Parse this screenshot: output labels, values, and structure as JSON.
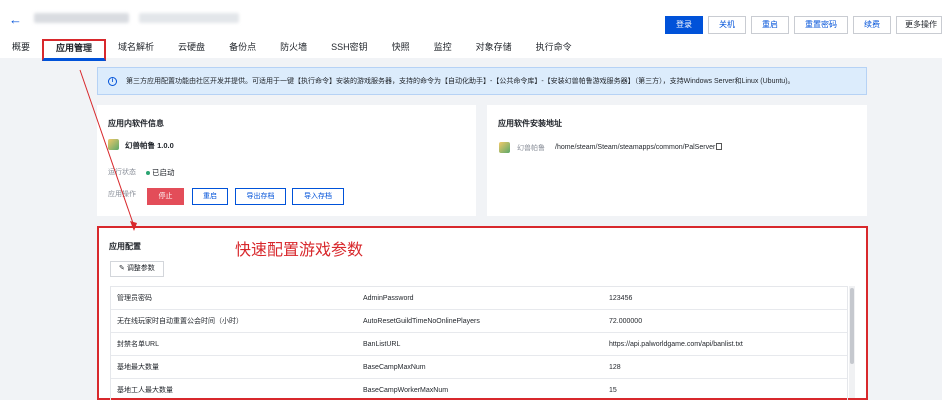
{
  "header": {
    "back_glyph": "←",
    "actions": [
      "登录",
      "关机",
      "重启",
      "重置密码",
      "续费",
      "更多操作"
    ]
  },
  "tabs": [
    "概要",
    "应用管理",
    "域名解析",
    "云硬盘",
    "备份点",
    "防火墙",
    "SSH密钥",
    "快照",
    "监控",
    "对象存储",
    "执行命令"
  ],
  "notice": {
    "icon": "info-icon",
    "text": "第三方应用配置功能由社区开发并提供。可适用于一键【执行命令】安装的游戏服务器，支持的命令为【自动化助手】-【公共命令库】-【安装幻兽帕鲁游戏服务器】（第三方），支持Windows Server和Linux (Ubuntu)。"
  },
  "software_info": {
    "title": "应用内软件信息",
    "app_name": "幻兽帕鲁 1.0.0",
    "status_label": "运行状态",
    "status_value": "已启动",
    "ops_label": "应用操作",
    "ops": [
      "停止",
      "重启",
      "导出存档",
      "导入存档"
    ]
  },
  "install_path": {
    "title": "应用软件安装地址",
    "app_label": "幻兽帕鲁",
    "path": "/home/steam/Steam/steamapps/common/PalServer"
  },
  "config": {
    "title": "应用配置",
    "annotation": "快速配置游戏参数",
    "adjust_button": "调整参数",
    "rows": [
      [
        "管理员密码",
        "AdminPassword",
        "123456"
      ],
      [
        "无在线玩家时自动重置公会时间（小时）",
        "AutoResetGuildTimeNoOnlinePlayers",
        "72.000000"
      ],
      [
        "封禁名单URL",
        "BanListURL",
        "https://api.palworldgame.com/api/banlist.txt"
      ],
      [
        "基地最大数量",
        "BaseCampMaxNum",
        "128"
      ],
      [
        "基地工人最大数量",
        "BaseCampWorkerMaxNum",
        "15"
      ]
    ]
  },
  "colors": {
    "accent": "#0052d9",
    "annotation_red": "#d8282c",
    "danger": "#e34d59",
    "running_green": "#2ba471"
  }
}
